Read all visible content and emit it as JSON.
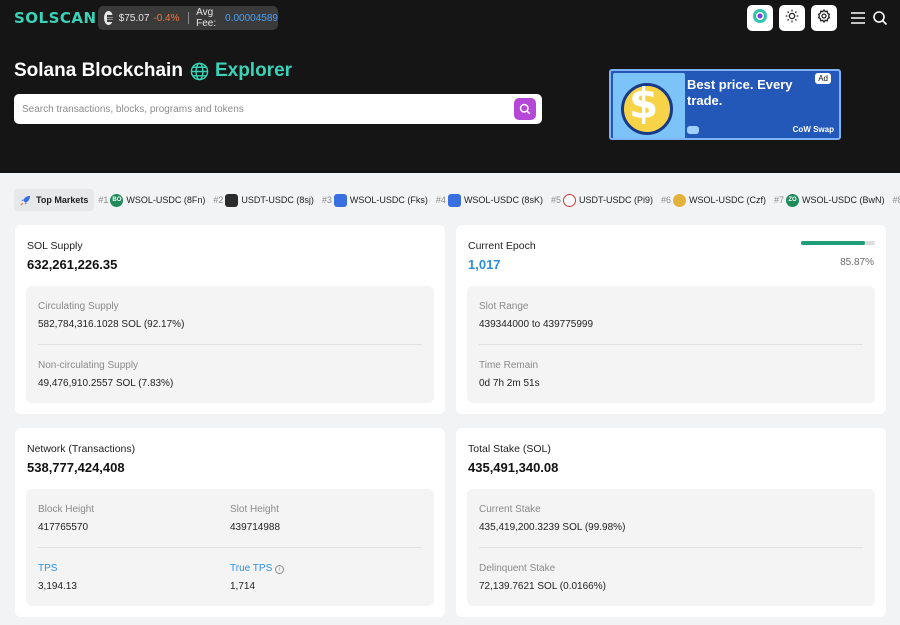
{
  "header": {
    "logo": "SOLSCAN",
    "sol_price": "$75.07",
    "sol_change": "-0.4%",
    "avg_fee_label": "Avg Fee:",
    "avg_fee_value": "0.00004589"
  },
  "hero": {
    "title_part1": "Solana Blockchain",
    "title_part2": "Explorer",
    "search_placeholder": "Search transactions, blocks, programs and tokens"
  },
  "ad": {
    "badge": "Ad",
    "headline": "Best price. Every trade.",
    "brand": "CoW Swap"
  },
  "markets": {
    "label": "Top Markets",
    "items": [
      {
        "rank": "#1",
        "pair": "WSOL-USDC (8Fn)",
        "icon_text": "BO",
        "color": "#1f8a5a"
      },
      {
        "rank": "#2",
        "pair": "USDT-USDC (8sj)",
        "icon_text": "",
        "color": "#2b2b2b"
      },
      {
        "rank": "#3",
        "pair": "WSOL-USDC (Fks)",
        "icon_text": "",
        "color": "#3a6fe0"
      },
      {
        "rank": "#4",
        "pair": "WSOL-USDC (8sK)",
        "icon_text": "",
        "color": "#3a6fe0"
      },
      {
        "rank": "#5",
        "pair": "USDT-USDC (Pi9)",
        "icon_text": "",
        "color": "#d23a3a"
      },
      {
        "rank": "#6",
        "pair": "WSOL-USDC (Czf)",
        "icon_text": "",
        "color": "#e6b13a"
      },
      {
        "rank": "#7",
        "pair": "WSOL-USDC (BwN)",
        "icon_text": "ZO",
        "color": "#1f8a5a"
      },
      {
        "rank": "#8",
        "pair": "",
        "icon_text": "",
        "color": "#9a9a9a"
      }
    ]
  },
  "sol_supply": {
    "label": "SOL Supply",
    "value": "632,261,226.35",
    "circ_label": "Circulating Supply",
    "circ_value": "582,784,316.1028 SOL (92.17%)",
    "noncirc_label": "Non-circulating Supply",
    "noncirc_value": "49,476,910.2557 SOL (7.83%)"
  },
  "epoch": {
    "label": "Current Epoch",
    "value": "1,017",
    "progress_pct": "85.87%",
    "progress_fraction": 0.8587,
    "slot_range_label": "Slot Range",
    "slot_range_value": "439344000 to 439775999",
    "time_remain_label": "Time Remain",
    "time_remain_value": "0d 7h 2m 51s"
  },
  "network": {
    "label": "Network (Transactions)",
    "value": "538,777,424,408",
    "block_height_label": "Block Height",
    "block_height_value": "417765570",
    "slot_height_label": "Slot Height",
    "slot_height_value": "439714988",
    "tps_label": "TPS",
    "tps_value": "3,194.13",
    "true_tps_label": "True TPS",
    "true_tps_value": "1,714"
  },
  "stake": {
    "label": "Total Stake (SOL)",
    "value": "435,491,340.08",
    "current_label": "Current Stake",
    "current_value": "435,419,200.3239 SOL (99.98%)",
    "delinquent_label": "Delinquent Stake",
    "delinquent_value": "72,139.7621 SOL (0.0166%)"
  }
}
